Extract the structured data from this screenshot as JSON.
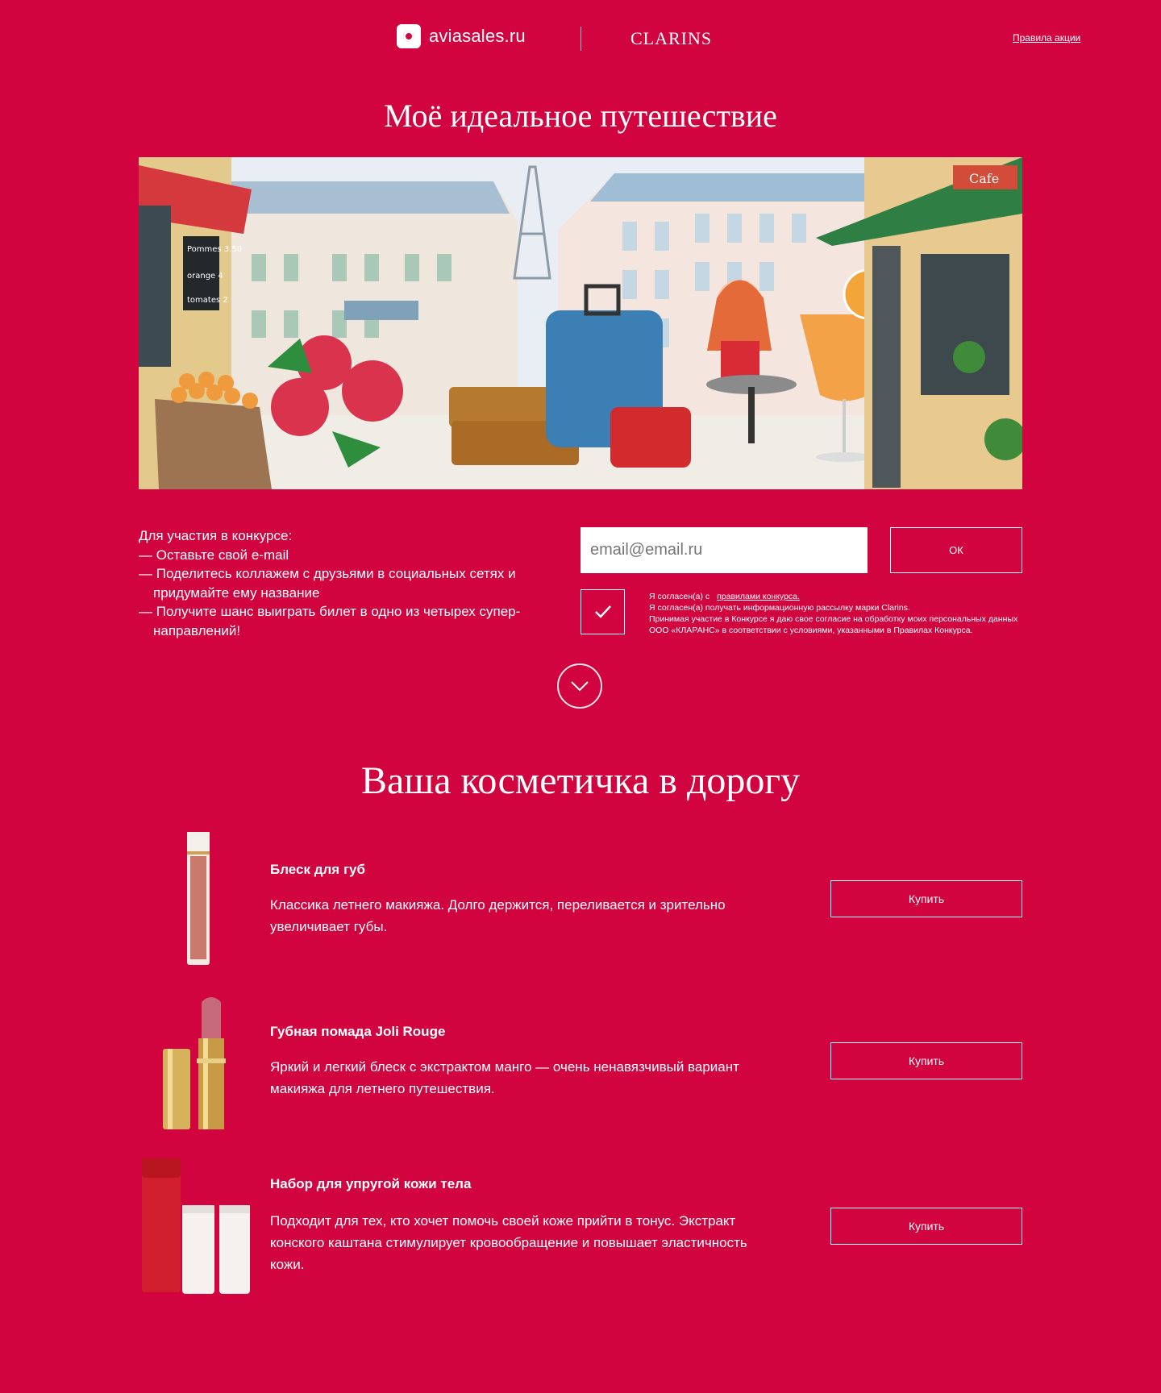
{
  "header": {
    "avia_logo_text": "aviasales.ru",
    "clarins_logo_text": "CLARINS",
    "rules_link": "Правила акции"
  },
  "hero": {
    "title": "Моё идеальное путешествие",
    "image_icon": "paris-street-illustration",
    "chalkboard": [
      "Pommes 3.50",
      "orange 4",
      "tomates 2"
    ],
    "cafe_sign": "Cafe"
  },
  "form": {
    "instructions_title": "Для участия в конкурсе:",
    "instructions": [
      "— Оставьте свой e-mail",
      "— Поделитесь коллажем с друзьями в социальных сетях и придумайте ему название",
      "— Получите шанс выиграть билет в одно из четырех супер-направлений!"
    ],
    "email_placeholder": "email@email.ru",
    "ok_label": "ОК",
    "consent_line1_prefix": "Я согласен(а) с",
    "consent_line1_link": "правилами конкурса.",
    "consent_line2": "Я согласен(а) получать информационную рассылку марки Clarins.",
    "consent_line3": "Принимая участие в Конкурсе я даю свое согласие на обработку моих персональных данных ООО «КЛАРАНС» в соответствии с условиями, указанными в Правилах Конкурса.",
    "consent_checked": true
  },
  "products_section": {
    "title": "Ваша косметичка в дорогу",
    "buy_label": "Купить",
    "items": [
      {
        "name": "Блеск для губ",
        "description": "Классика летнего макияжа. Долго держится, переливается и зрительно увеличивает губы.",
        "image_icon": "lip-gloss-image"
      },
      {
        "name": "Губная помада Joli Rouge",
        "description": "Яркий и легкий блеск с экстрактом манго — очень ненавязчивый вариант макияжа для летнего путешествия.",
        "image_icon": "lipstick-image"
      },
      {
        "name": "Набор для упругой кожи тела",
        "description": "Подходит для тех, кто хочет помочь своей коже прийти в тонус. Экстракт конского каштана стимулирует кровообращение и повышает эластичность кожи.",
        "image_icon": "body-care-set-image"
      }
    ]
  },
  "colors": {
    "background": "#d1043f",
    "text": "#ffffff"
  }
}
